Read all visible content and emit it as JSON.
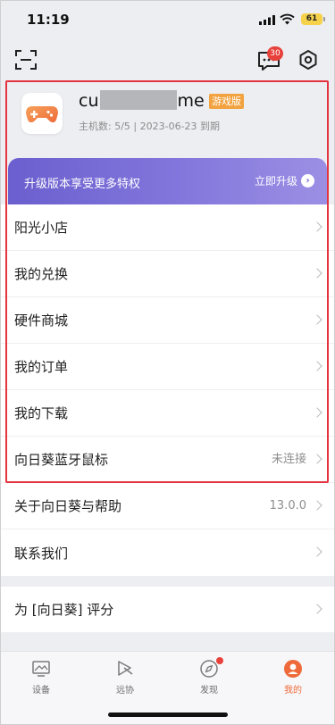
{
  "status_bar": {
    "time": "11:19",
    "battery": "61"
  },
  "toolbar": {
    "message_count": "30"
  },
  "profile": {
    "username_prefix": "cu",
    "username_suffix": "me",
    "edition_badge": "游戏版",
    "host_info": "主机数: 5/5 | 2023-06-23 到期"
  },
  "upgrade": {
    "text": "升级版本享受更多特权",
    "action": "立即升级"
  },
  "menu": {
    "items": [
      {
        "label": "阳光小店",
        "value": ""
      },
      {
        "label": "我的兑换",
        "value": ""
      },
      {
        "label": "硬件商城",
        "value": ""
      },
      {
        "label": "我的订单",
        "value": ""
      },
      {
        "label": "我的下载",
        "value": ""
      },
      {
        "label": "向日葵蓝牙鼠标",
        "value": "未连接"
      },
      {
        "label": "关于向日葵与帮助",
        "value": "13.0.0"
      },
      {
        "label": "联系我们",
        "value": ""
      }
    ],
    "rate": {
      "label": "为 [向日葵] 评分"
    }
  },
  "tabs": [
    {
      "label": "设备",
      "icon": "device-icon",
      "active": false
    },
    {
      "label": "远协",
      "icon": "remote-assist-icon",
      "active": false
    },
    {
      "label": "发现",
      "icon": "compass-icon",
      "active": false,
      "dot": true
    },
    {
      "label": "我的",
      "icon": "profile-icon",
      "active": true
    }
  ],
  "colors": {
    "accent": "#ee6a3a",
    "banner_start": "#6b5fcf",
    "banner_end": "#9b8fe4",
    "badge": "#f2a23f",
    "highlight": "#e4343f"
  }
}
